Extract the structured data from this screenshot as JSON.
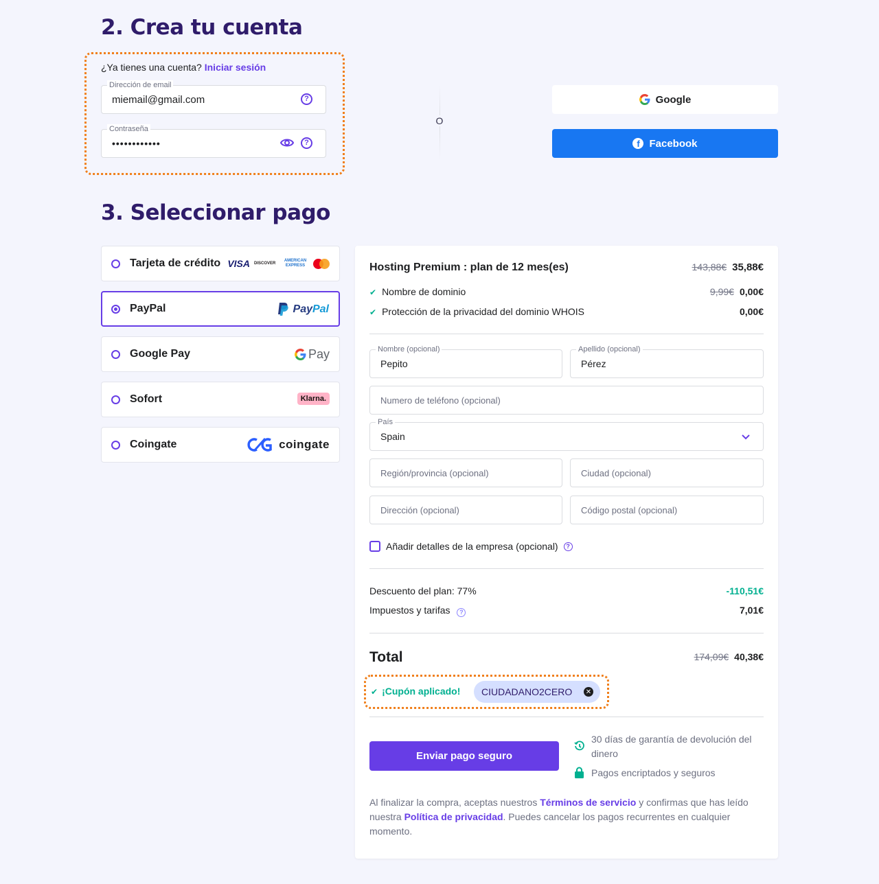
{
  "account": {
    "title": "2. Crea tu cuenta",
    "have_account": "¿Ya tienes una cuenta?",
    "login_link": "Iniciar sesión",
    "email_label": "Dirección de email",
    "email_value": "miemail@gmail.com",
    "password_label": "Contraseña",
    "password_value": "••••••••••••",
    "or": "O",
    "google_label": "Google",
    "facebook_label": "Facebook"
  },
  "payment": {
    "title": "3. Seleccionar pago",
    "methods": [
      {
        "label": "Tarjeta de crédito",
        "selected": false
      },
      {
        "label": "PayPal",
        "selected": true
      },
      {
        "label": "Google Pay",
        "selected": false
      },
      {
        "label": "Sofort",
        "selected": false
      },
      {
        "label": "Coingate",
        "selected": false
      }
    ],
    "logos": {
      "visa": "VISA",
      "discover": "DISCOVER",
      "amex": "AMERICAN EXPRESS",
      "paypal_pay": "Pay",
      "paypal_pal": "Pal",
      "gpay": "Pay",
      "klarna": "Klarna.",
      "coingate": "coingate"
    }
  },
  "summary": {
    "plan": "Hosting Premium : plan de 12 mes(es)",
    "plan_old": "143,88€",
    "plan_price": "35,88€",
    "items": [
      {
        "label": "Nombre de dominio",
        "old": "9,99€",
        "price": "0,00€"
      },
      {
        "label": "Protección de la privacidad del dominio WHOIS",
        "old": "",
        "price": "0,00€"
      }
    ],
    "form": {
      "first_name_label": "Nombre (opcional)",
      "first_name_value": "Pepito",
      "last_name_label": "Apellido (opcional)",
      "last_name_value": "Pérez",
      "phone_placeholder": "Numero de teléfono (opcional)",
      "country_label": "País",
      "country_value": "Spain",
      "region_placeholder": "Región/provincia (opcional)",
      "city_placeholder": "Ciudad (opcional)",
      "address_placeholder": "Dirección (opcional)",
      "zip_placeholder": "Código postal (opcional)",
      "company_label": "Añadir detalles de la empresa (opcional)"
    },
    "discount_label": "Descuento del plan: 77%",
    "discount_value": "-110,51€",
    "taxes_label": "Impuestos y tarifas",
    "taxes_value": "7,01€",
    "total_label": "Total",
    "total_old": "174,09€",
    "total_value": "40,38€",
    "coupon_applied": "¡Cupón aplicado!",
    "coupon_code": "CIUDADANO2CERO",
    "submit_label": "Enviar pago seguro",
    "guarantee": "30 días de garantía de devolución del dinero",
    "secure": "Pagos encriptados y seguros",
    "legal_1": "Al finalizar la compra, aceptas nuestros",
    "terms_link": "Términos de servicio",
    "legal_2": "y confirmas que has leído nuestra",
    "privacy_link": "Política de privacidad",
    "legal_3": ". Puedes cancelar los pagos recurrentes en cualquier momento."
  },
  "colors": {
    "primary": "#673de6",
    "heading": "#2f1c6a",
    "facebook": "#1877f2",
    "success": "#00b090",
    "highlight": "#f07f1a"
  }
}
